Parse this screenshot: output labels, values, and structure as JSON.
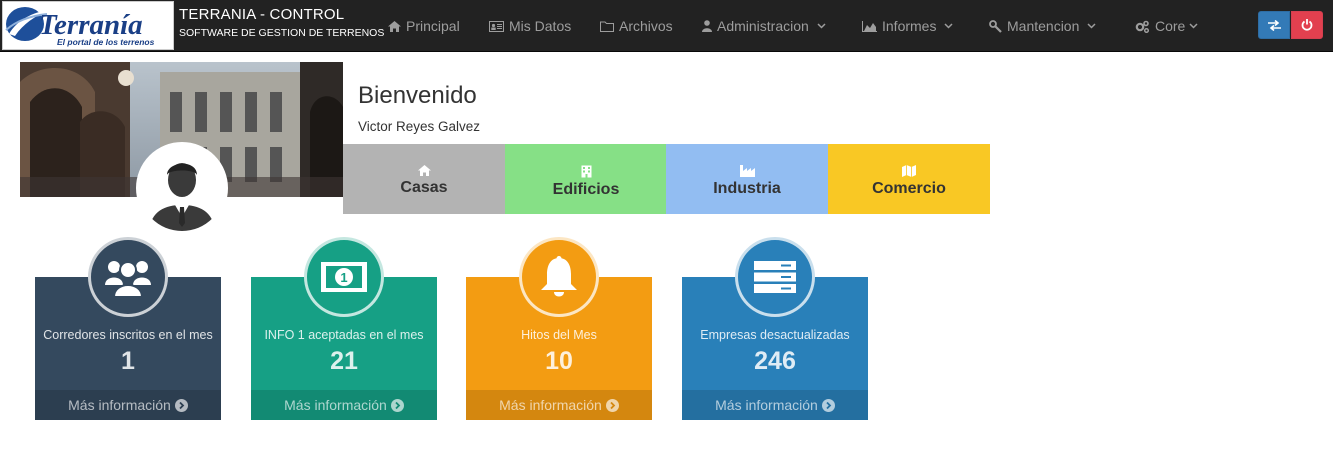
{
  "header": {
    "logo_text": "Terranía",
    "logo_tagline": "El portal de los terrenos",
    "brand_title": "TERRANIA - CONTROL",
    "brand_subtitle": "SOFTWARE DE GESTION DE TERRENOS",
    "nav": [
      {
        "label": "Principal",
        "icon": "home-icon"
      },
      {
        "label": "Mis Datos",
        "icon": "id-card-icon"
      },
      {
        "label": "Archivos",
        "icon": "folder-icon"
      },
      {
        "label": "Administracion",
        "icon": "user-icon",
        "dropdown": true
      },
      {
        "label": "Informes",
        "icon": "area-chart-icon",
        "dropdown": true
      },
      {
        "label": "Mantencion",
        "icon": "wrench-icon",
        "dropdown": true
      },
      {
        "label": "Core",
        "icon": "cogs-icon",
        "dropdown": true
      }
    ],
    "actions": [
      {
        "name": "swap-user-button",
        "icon": "exchange-icon",
        "color": "#337ab7"
      },
      {
        "name": "logout-button",
        "icon": "power-icon",
        "color": "#e2404f"
      }
    ]
  },
  "profile": {
    "welcome": "Bienvenido",
    "user_name": "Victor Reyes Galvez"
  },
  "categories": [
    {
      "label": "Casas",
      "icon": "home-icon",
      "color": "#b3b3b3"
    },
    {
      "label": "Edificios",
      "icon": "building-icon",
      "color": "#86e086"
    },
    {
      "label": "Industria",
      "icon": "industry-icon",
      "color": "#92bdf2"
    },
    {
      "label": "Comercio",
      "icon": "map-icon",
      "color": "#f9c824"
    }
  ],
  "stats": [
    {
      "label": "Corredores inscritos en el mes",
      "value": "1",
      "more": "Más información",
      "icon": "users-icon",
      "color": "#34495e",
      "footer_color": "#2c3e50"
    },
    {
      "label": "INFO 1 aceptadas en el mes",
      "value": "21",
      "more": "Más información",
      "icon": "money-icon",
      "color": "#16a085",
      "footer_color": "#128a73"
    },
    {
      "label": "Hitos del Mes",
      "value": "10",
      "more": "Más información",
      "icon": "bell-icon",
      "color": "#f39c12",
      "footer_color": "#d4870f"
    },
    {
      "label": "Empresas desactualizadas",
      "value": "246",
      "more": "Más información",
      "icon": "server-icon",
      "color": "#2980b9",
      "footer_color": "#246fa0"
    }
  ]
}
